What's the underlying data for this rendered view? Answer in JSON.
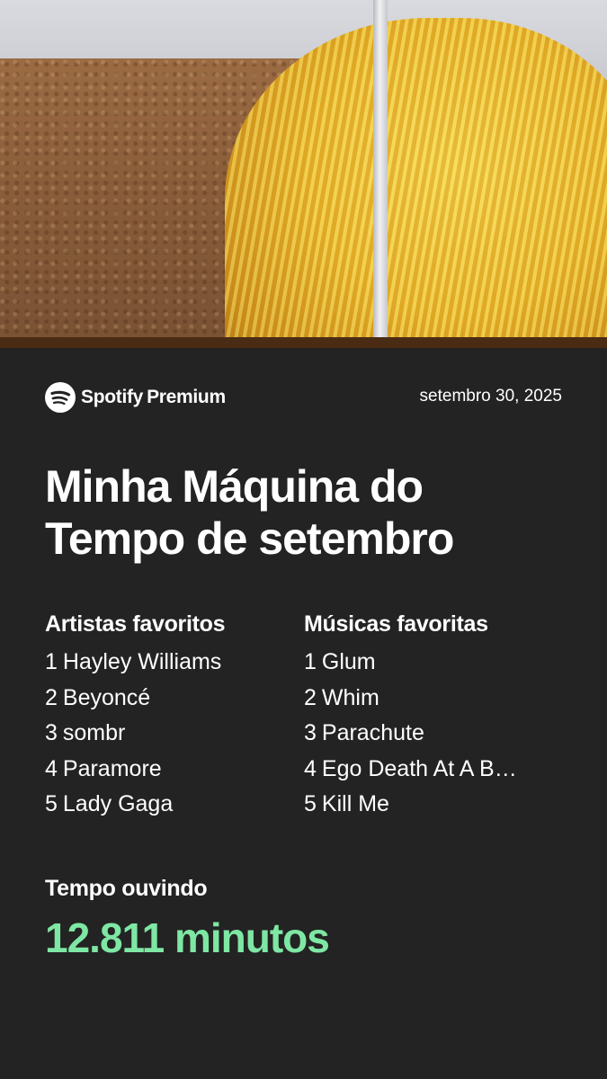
{
  "brand": {
    "name": "Spotify",
    "tier": "Premium",
    "icon": "spotify-logo-icon"
  },
  "date": "setembro 30, 2025",
  "title": "Minha Máquina do Tempo de setembro",
  "top_artists": {
    "heading": "Artistas favoritos",
    "items": [
      {
        "rank": "1",
        "name": "Hayley Williams"
      },
      {
        "rank": "2",
        "name": "Beyoncé"
      },
      {
        "rank": "3",
        "name": "sombr"
      },
      {
        "rank": "4",
        "name": "Paramore"
      },
      {
        "rank": "5",
        "name": "Lady Gaga"
      }
    ]
  },
  "top_tracks": {
    "heading": "Músicas favoritas",
    "items": [
      {
        "rank": "1",
        "name": "Glum"
      },
      {
        "rank": "2",
        "name": "Whim"
      },
      {
        "rank": "3",
        "name": "Parachute"
      },
      {
        "rank": "4",
        "name": "Ego Death At A B…"
      },
      {
        "rank": "5",
        "name": "Kill Me"
      }
    ]
  },
  "listening_time": {
    "label": "Tempo ouvindo",
    "value": "12.811 minutos"
  },
  "colors": {
    "background": "#232323",
    "accent_green": "#7ee7a3",
    "text": "#ffffff"
  }
}
